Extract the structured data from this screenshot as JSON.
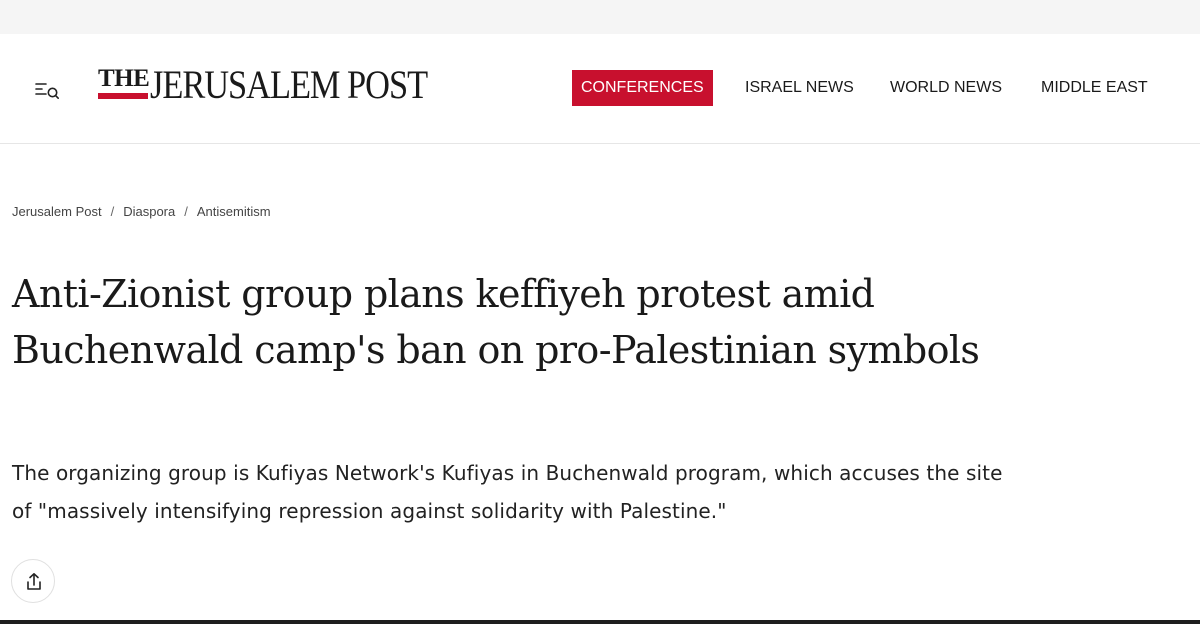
{
  "header": {
    "menu_icon": "menu-search-icon",
    "logo": {
      "the": "THE",
      "name": "JERUSALEM POST"
    },
    "nav": [
      {
        "label": "CONFERENCES",
        "active": true
      },
      {
        "label": "ISRAEL NEWS",
        "active": false
      },
      {
        "label": "WORLD NEWS",
        "active": false
      },
      {
        "label": "MIDDLE EAST",
        "active": false
      }
    ]
  },
  "breadcrumb": [
    "Jerusalem Post",
    "Diaspora",
    "Antisemitism"
  ],
  "breadcrumb_separator": "/",
  "article": {
    "title": "Anti-Zionist group plans keffiyeh protest amid Buchenwald camp's ban on pro-Palestinian symbols",
    "subtitle": "The organizing group is Kufiyas Network's Kufiyas in Buchenwald program, which accuses the site of \"massively intensifying repression against solidarity with Palestine.\"",
    "share_icon": "share-icon"
  },
  "colors": {
    "brand_red": "#c8102e",
    "text": "#1a1a1a",
    "top_strip": "#f5f5f5"
  }
}
